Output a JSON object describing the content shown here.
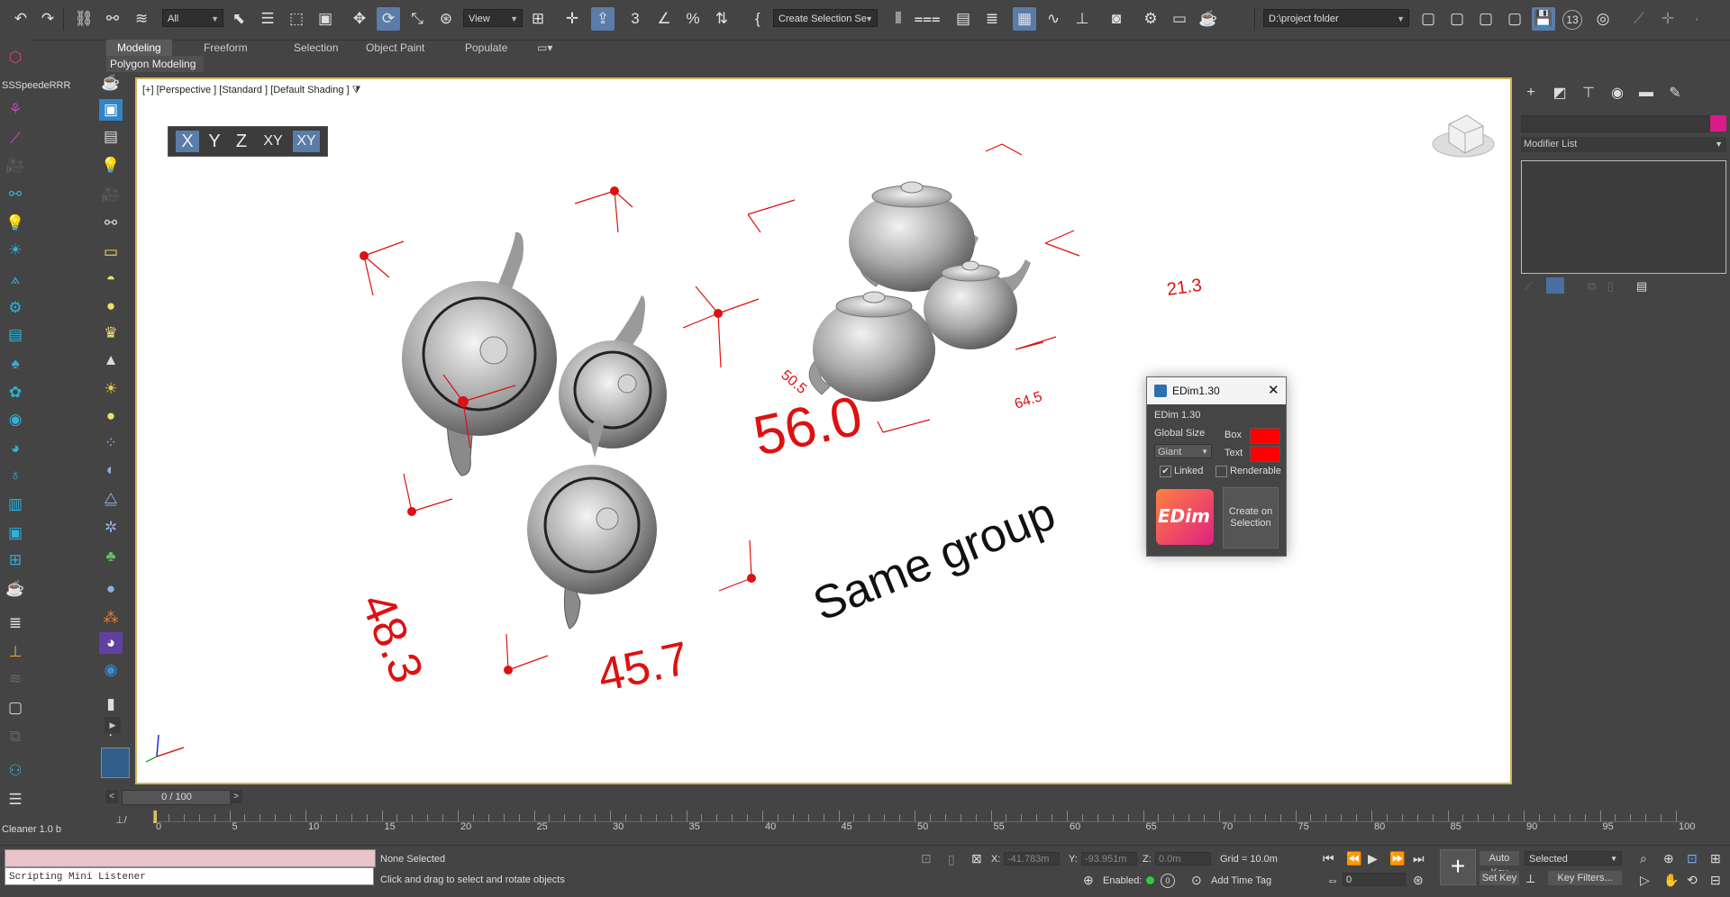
{
  "toolbar": {
    "selection_filter": "All",
    "ref_coord": "View",
    "named_selection": "Create Selection Se",
    "project_folder": "D:\\project folder",
    "counter_badge": "13"
  },
  "ribbon": {
    "tabs": [
      "Modeling",
      "Freeform",
      "Selection",
      "Object Paint",
      "Populate"
    ],
    "active_tab": "Modeling",
    "sub_label": "Polygon Modeling"
  },
  "left_rail": {
    "ss_label": "SSSpeedeRRR",
    "cleaner_label": "Cleaner 1.0 b"
  },
  "viewport": {
    "label": "[+] [Perspective ] [Standard ] [Default Shading ]",
    "axis_buttons": [
      "X",
      "Y",
      "Z",
      "XY",
      "XY"
    ],
    "dimensions": [
      "56.0",
      "48.3",
      "45.7",
      "50.5",
      "64.5",
      "21.3"
    ],
    "group_text": "Same group"
  },
  "command_panel": {
    "modifier_list": "Modifier List"
  },
  "edim_dialog": {
    "title": "EDim1.30",
    "version": "EDim 1.30",
    "global_size_label": "Global Size",
    "global_size_value": "Giant",
    "box_label": "Box",
    "text_label": "Text",
    "linked_label": "Linked",
    "linked_checked": true,
    "renderable_label": "Renderable",
    "renderable_checked": false,
    "logo_text": "EDim",
    "create_button": "Create on Selection",
    "box_color": "#ff0000",
    "text_color": "#ff0000"
  },
  "time_slider": {
    "position": "0 / 100"
  },
  "trackbar": {
    "labels": [
      "0",
      "5",
      "10",
      "15",
      "20",
      "25",
      "30",
      "35",
      "40",
      "45",
      "50",
      "55",
      "60",
      "65",
      "70",
      "75",
      "80",
      "85",
      "90",
      "95",
      "100"
    ]
  },
  "statusbar": {
    "listener_placeholder": "Scripting Mini Listener",
    "selection_status": "None Selected",
    "prompt": "Click and drag to select and rotate objects",
    "x_label": "X:",
    "x_value": "-41.783m",
    "y_label": "Y:",
    "y_value": "-93.951m",
    "z_label": "Z:",
    "z_value": "0.0m",
    "grid": "Grid = 10.0m",
    "enabled_label": "Enabled:",
    "add_time_tag": "Add Time Tag",
    "auto_key": "Auto Key",
    "set_key": "Set Key",
    "key_mode": "Selected",
    "frame": "0",
    "key_filters": "Key Filters..."
  }
}
